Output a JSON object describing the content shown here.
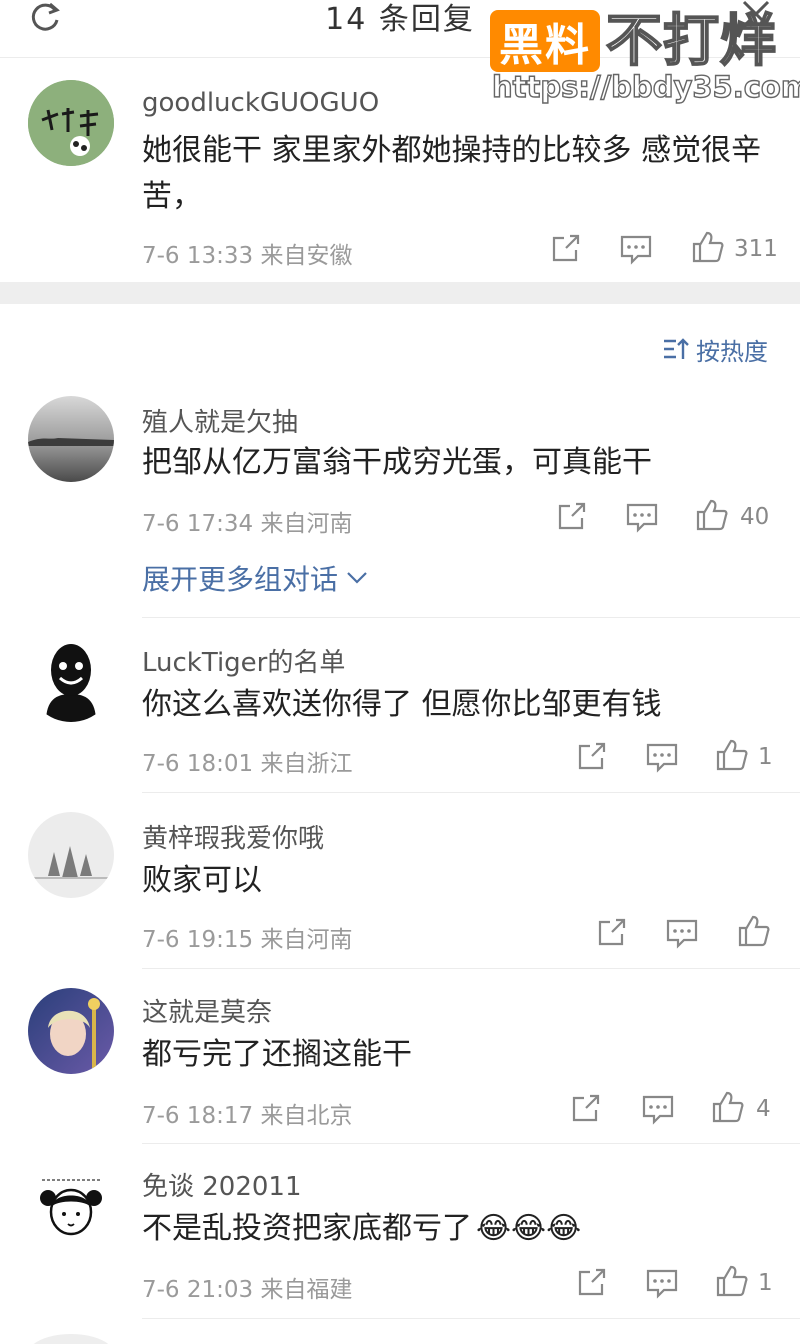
{
  "header": {
    "title": "14 条回复"
  },
  "watermark": {
    "badge": "黑料",
    "text": "不打烊",
    "url": "https://bbdy35.com"
  },
  "sort": {
    "label": "按热度"
  },
  "expand": {
    "label": "展开更多组对话"
  },
  "colors": {
    "link": "#4a6fa5",
    "meta": "#9a9a9a",
    "accent_watermark": "#ff8a00"
  },
  "comments": [
    {
      "user": "goodluckGUOGUO",
      "text": "她很能干 家里家外都她操持的比较多 感觉很辛苦，",
      "time": "7-6 13:33",
      "location": "来自安徽",
      "likes": "311"
    },
    {
      "user": "殖人就是欠抽",
      "text": "把邹从亿万富翁干成穷光蛋，可真能干",
      "time": "7-6 17:34",
      "location": "来自河南",
      "likes": "40"
    },
    {
      "user": "LuckTiger的名单",
      "text": "你这么喜欢送你得了 但愿你比邹更有钱",
      "time": "7-6 18:01",
      "location": "来自浙江",
      "likes": "1"
    },
    {
      "user": "黄梓瑕我爱你哦",
      "text": "败家可以",
      "time": "7-6 19:15",
      "location": "来自河南",
      "likes": ""
    },
    {
      "user": "这就是莫奈",
      "text": "都亏完了还搁这能干",
      "time": "7-6 18:17",
      "location": "来自北京",
      "likes": "4"
    },
    {
      "user": "免谈 202011",
      "text": "不是乱投资把家底都亏了",
      "emoji": "😂😂😂",
      "time": "7-6 21:03",
      "location": "来自福建",
      "likes": "1"
    }
  ]
}
